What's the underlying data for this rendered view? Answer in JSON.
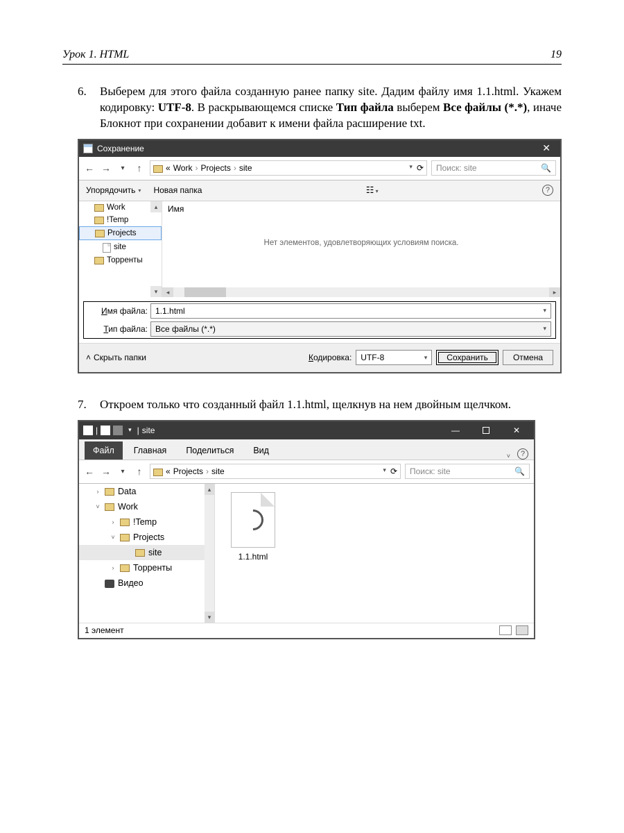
{
  "header": {
    "title": "Урок 1. HTML",
    "page": "19"
  },
  "step6": {
    "num": "6.",
    "t1": "Выберем для этого файла созданную ранее папку site. Дадим файлу имя 1.1.html. Укажем кодировку: ",
    "b1": "UTF-8",
    "t2": ". В раскрывающемся списке ",
    "b2": "Тип файла",
    "t3": " выберем ",
    "b3": "Все файлы (*.*)",
    "t4": ", иначе Блокнот при сохранении добавит к имени файла расширение txt."
  },
  "saveDlg": {
    "title": "Сохранение",
    "crumbs": [
      "«",
      "Work",
      "Projects",
      "site"
    ],
    "searchPh": "Поиск: site",
    "organize": "Упорядочить",
    "newFolder": "Новая папка",
    "tree": [
      "Work",
      "!Temp",
      "Projects",
      "site",
      "Торренты"
    ],
    "colName": "Имя",
    "emptyMsg": "Нет элементов, удовлетворяющих условиям поиска.",
    "labels": {
      "fname": "Имя файла:",
      "ftype": "Тип файла:",
      "hide": "Скрыть папки",
      "enc": "Кодировка:"
    },
    "fname": "1.1.html",
    "ftype": "Все файлы  (*.*)",
    "encoding": "UTF-8",
    "saveBtn": "Сохранить",
    "cancelBtn": "Отмена"
  },
  "step7": {
    "num": "7.",
    "text": "Откроем только что созданный файл 1.1.html, щелкнув на нем двойным щелчком."
  },
  "explorer": {
    "titleName": "site",
    "tabs": {
      "file": "Файл",
      "home": "Главная",
      "share": "Поделиться",
      "view": "Вид"
    },
    "crumbs": [
      "«",
      "Projects",
      "site"
    ],
    "searchPh": "Поиск: site",
    "tree": {
      "data": "Data",
      "work": "Work",
      "temp": "!Temp",
      "projects": "Projects",
      "site": "site",
      "torrents": "Торренты",
      "video": "Видео"
    },
    "fileName": "1.1.html",
    "status": "1 элемент"
  }
}
